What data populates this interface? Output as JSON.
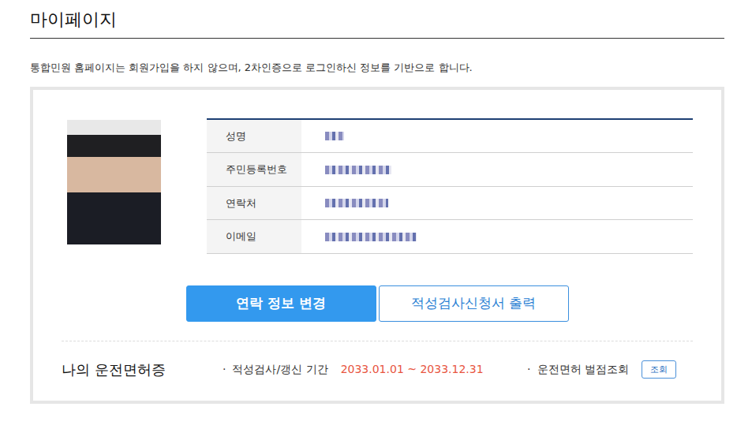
{
  "page": {
    "title": "마이페이지",
    "notice": "통합민원 홈페이지는 회원가입을 하지 않으며, 2차인증으로 로그인하신 정보를 기반으로 합니다."
  },
  "profile": {
    "fields": [
      {
        "label": "성명",
        "masked": true
      },
      {
        "label": "주민등록번호",
        "masked": true
      },
      {
        "label": "연락처",
        "masked": true
      },
      {
        "label": "이메일",
        "masked": true
      }
    ]
  },
  "buttons": [
    {
      "label": "연락 정보 변경",
      "kind": "filled"
    },
    {
      "label": "적성검사신청서 출력",
      "kind": "outline"
    }
  ],
  "license": {
    "title": "나의 운전면허증",
    "items": [
      {
        "bullet": "·",
        "label": "적성검사/갱신 기간",
        "value": "2033.01.01 ~ 2033.12.31"
      },
      {
        "bullet": "·",
        "label": "운전면허 벌점조회",
        "button": "조회"
      }
    ]
  }
}
